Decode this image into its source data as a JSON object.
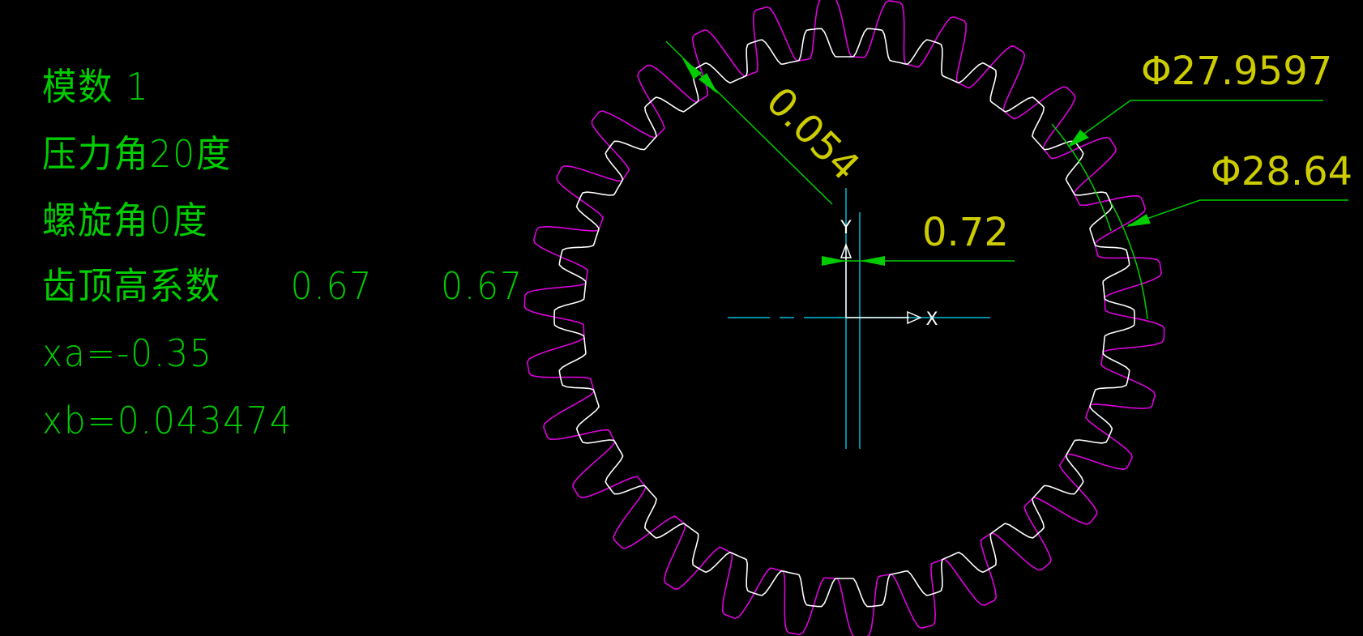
{
  "notes": {
    "module": "模数 1",
    "pressure_angle": "压力角20度",
    "helix_angle": "螺旋角0度",
    "addendum_label": "齿顶高系数",
    "addendum_a": "0.67",
    "addendum_b": "0.67",
    "xa": "xa=-0.35",
    "xb": "xb=0.043474"
  },
  "dimensions": {
    "d_inner": "Φ27.9597",
    "d_outer": "Φ28.64",
    "offset": "0.72",
    "radial": "0.054"
  },
  "axis_labels": {
    "x": "X",
    "y": "Y"
  },
  "colors": {
    "background": "#000000",
    "text": "#00cc00",
    "dimension_text": "#cccc00",
    "dimension_line": "#00cc00",
    "gear_profile": "#ffffff",
    "cutter_profile": "#dd00dd",
    "centerline": "#00bcd4"
  },
  "gear": {
    "teeth": 30
  }
}
